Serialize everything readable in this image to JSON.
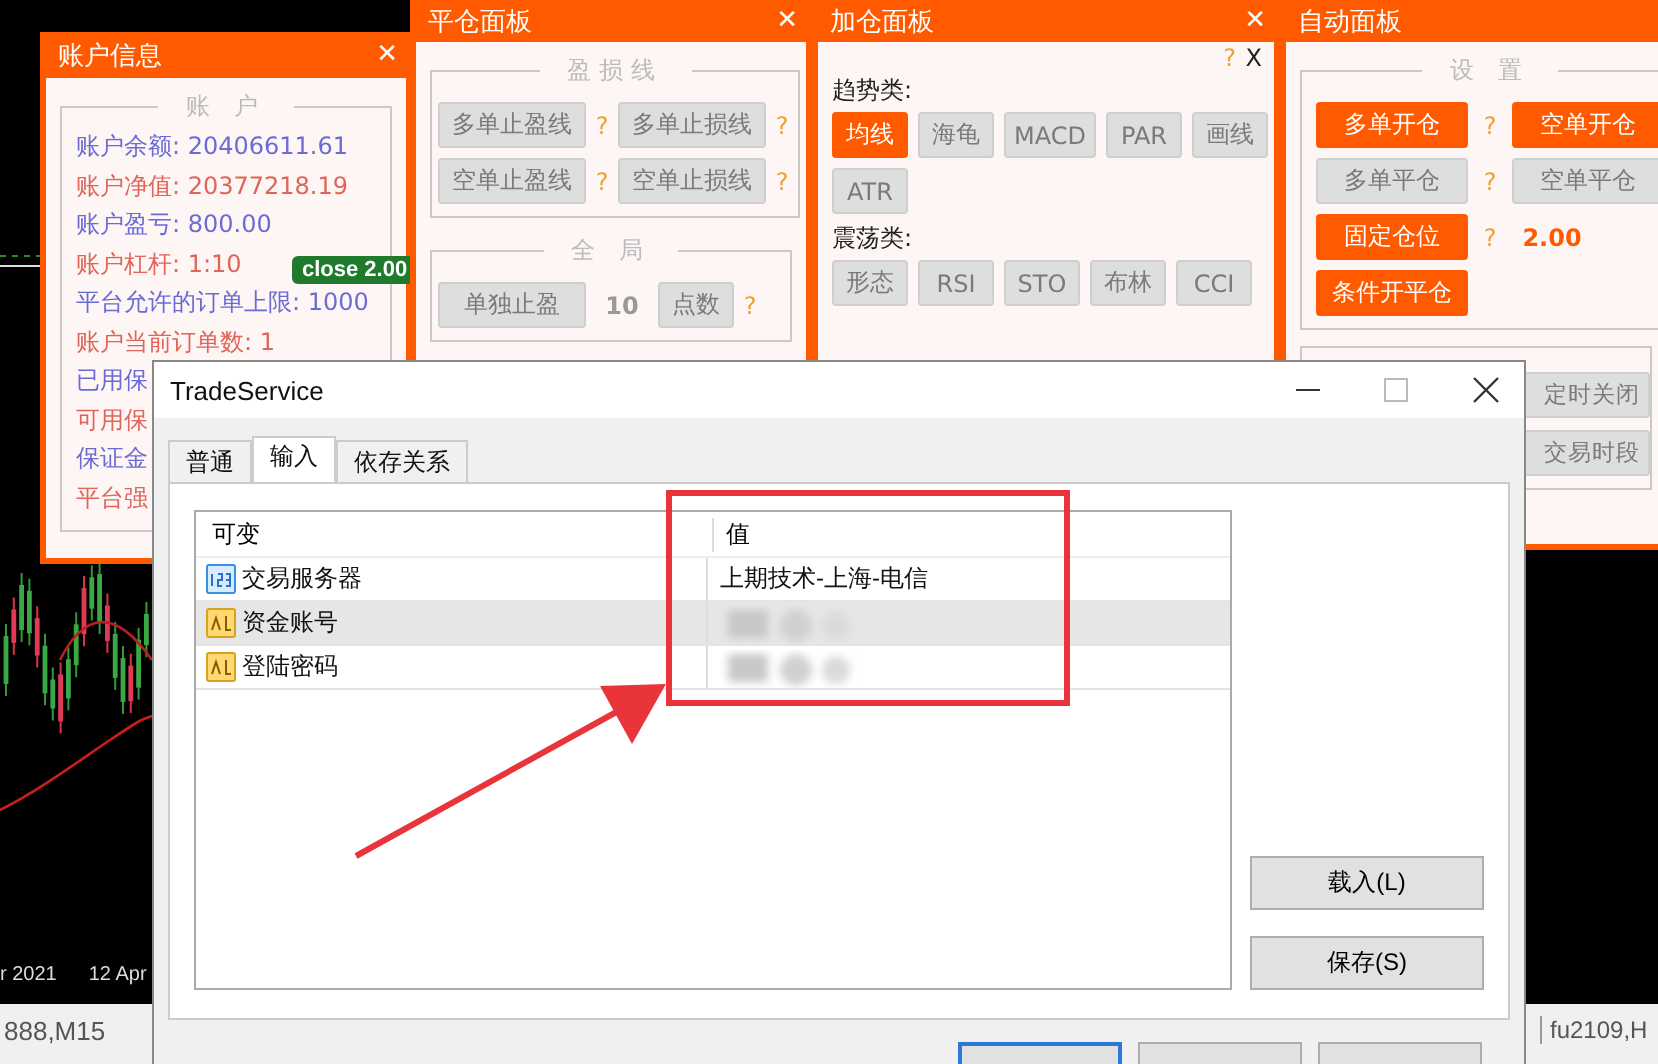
{
  "chart": {
    "axis_labels": [
      "r 2021",
      "12 Apr"
    ]
  },
  "terminal_tabs": [
    "888,M15",
    "fu2109,H"
  ],
  "account_panel": {
    "title": "账户信息",
    "close": "✕",
    "legend": "账 户",
    "badge": "close 2.00",
    "rows": [
      {
        "text": "账户余额: 20406611.61",
        "color": "#6b6bd6"
      },
      {
        "text": "账户净值: 20377218.19",
        "color": "#e0645a"
      },
      {
        "text": "账户盈亏: 800.00",
        "color": "#6b6bd6"
      },
      {
        "text": "账户杠杆: 1:10",
        "color": "#e0645a"
      },
      {
        "text": "平台允许的订单上限: 1000",
        "color": "#6b6bd6"
      },
      {
        "text": "账户当前订单数: 1",
        "color": "#e0645a"
      },
      {
        "text": "已用保",
        "color": "#6b6bd6"
      },
      {
        "text": "可用保",
        "color": "#e0645a"
      },
      {
        "text": "保证金",
        "color": "#6b6bd6"
      },
      {
        "text": "平台强",
        "color": "#e0645a"
      }
    ]
  },
  "close_panel": {
    "title": "平仓面板",
    "close": "✕",
    "groups": [
      {
        "legend": "盈损线",
        "rows": [
          [
            {
              "kind": "button",
              "label": "多单止盈线",
              "on": false
            },
            {
              "kind": "help",
              "label": "?"
            },
            {
              "kind": "button",
              "label": "多单止损线",
              "on": false
            },
            {
              "kind": "help",
              "label": "?"
            }
          ],
          [
            {
              "kind": "button",
              "label": "空单止盈线",
              "on": false
            },
            {
              "kind": "help",
              "label": "?"
            },
            {
              "kind": "button",
              "label": "空单止损线",
              "on": false
            },
            {
              "kind": "help",
              "label": "?"
            }
          ]
        ]
      },
      {
        "legend": "全 局",
        "rows": [
          [
            {
              "kind": "button",
              "label": "单独止盈",
              "on": false
            },
            {
              "kind": "value",
              "label": "10"
            },
            {
              "kind": "short",
              "label": "点数",
              "on": false
            },
            {
              "kind": "help",
              "label": "?"
            }
          ]
        ]
      }
    ]
  },
  "add_panel": {
    "title": "加仓面板",
    "close": "✕",
    "help": "?",
    "dismiss": "X",
    "groups": [
      {
        "label": "趋势类:",
        "buttons": [
          {
            "label": "均线",
            "on": true
          },
          {
            "label": "海龟",
            "on": false
          },
          {
            "label": "MACD",
            "on": false
          },
          {
            "label": "PAR",
            "on": false
          },
          {
            "label": "画线",
            "on": false
          },
          {
            "label": "ATR",
            "on": false
          }
        ]
      },
      {
        "label": "震荡类:",
        "buttons": [
          {
            "label": "形态",
            "on": false
          },
          {
            "label": "RSI",
            "on": false
          },
          {
            "label": "STO",
            "on": false
          },
          {
            "label": "布林",
            "on": false
          },
          {
            "label": "CCI",
            "on": false
          }
        ]
      }
    ]
  },
  "auto_panel": {
    "title": "自动面板",
    "legend": "设 置",
    "rows": [
      [
        {
          "kind": "button",
          "label": "多单开仓",
          "on": true
        },
        {
          "kind": "help",
          "label": "?"
        },
        {
          "kind": "button",
          "label": "空单开仓",
          "on": true
        }
      ],
      [
        {
          "kind": "button",
          "label": "多单平仓",
          "on": false
        },
        {
          "kind": "help",
          "label": "?"
        },
        {
          "kind": "button",
          "label": "空单平仓",
          "on": false
        }
      ],
      [
        {
          "kind": "button",
          "label": "固定仓位",
          "on": true
        },
        {
          "kind": "help",
          "label": "?"
        },
        {
          "kind": "value",
          "label": "2.00"
        }
      ],
      [
        {
          "kind": "button",
          "label": "条件开平仓",
          "on": true
        }
      ]
    ],
    "lower_buttons": [
      {
        "label": "定时关闭",
        "on": false
      },
      {
        "label": "交易时段",
        "on": false
      }
    ]
  },
  "dialog": {
    "title": "TradeService",
    "tabs": [
      {
        "label": "普通",
        "selected": false
      },
      {
        "label": "输入",
        "selected": true
      },
      {
        "label": "依存关系",
        "selected": false
      }
    ],
    "columns": [
      "可变",
      "值"
    ],
    "rows": [
      {
        "name": "交易服务器",
        "kind": "number",
        "value": "上期技术-上海-电信",
        "redacted": false,
        "selected": false
      },
      {
        "name": "资金账号",
        "kind": "text",
        "redacted": true,
        "selected": true
      },
      {
        "name": "登陆密码",
        "kind": "text",
        "redacted": true,
        "selected": false
      }
    ],
    "side_buttons": [
      "载入(L)",
      "保存(S)"
    ]
  }
}
